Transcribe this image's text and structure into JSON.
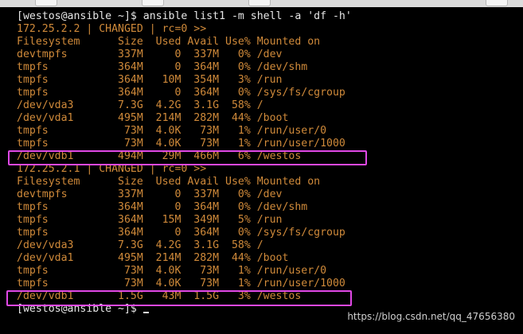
{
  "command": "[westos@ansible ~]$ ansible list1 -m shell -a 'df -h'",
  "hosts": [
    {
      "status": "172.25.2.2 | CHANGED | rc=0 >>",
      "header": "Filesystem      Size  Used Avail Use% Mounted on",
      "rows": [
        "devtmpfs        337M     0  337M   0% /dev",
        "tmpfs           364M     0  364M   0% /dev/shm",
        "tmpfs           364M   10M  354M   3% /run",
        "tmpfs           364M     0  364M   0% /sys/fs/cgroup",
        "/dev/vda3       7.3G  4.2G  3.1G  58% /",
        "/dev/vda1       495M  214M  282M  44% /boot",
        "tmpfs            73M  4.0K   73M   1% /run/user/0",
        "tmpfs            73M  4.0K   73M   1% /run/user/1000",
        "/dev/vdb1       494M   29M  466M   6% /westos"
      ]
    },
    {
      "status": "172.25.2.1 | CHANGED | rc=0 >>",
      "header": "Filesystem      Size  Used Avail Use% Mounted on",
      "rows": [
        "devtmpfs        337M     0  337M   0% /dev",
        "tmpfs           364M     0  364M   0% /dev/shm",
        "tmpfs           364M   15M  349M   5% /run",
        "tmpfs           364M     0  364M   0% /sys/fs/cgroup",
        "/dev/vda3       7.3G  4.2G  3.1G  58% /",
        "/dev/vda1       495M  214M  282M  44% /boot",
        "tmpfs            73M  4.0K   73M   1% /run/user/0",
        "tmpfs            73M  4.0K   73M   1% /run/user/1000",
        "/dev/vdb1       1.5G   43M  1.5G   3% /westos"
      ]
    }
  ],
  "final_prompt": "[westos@ansible ~]$ ",
  "watermark": "https://blog.csdn.net/qq_47656380",
  "colors": {
    "background": "#000000",
    "output_text": "#d08a3a",
    "prompt_text": "#e6e6e6",
    "highlight_box": "#e048e6"
  }
}
